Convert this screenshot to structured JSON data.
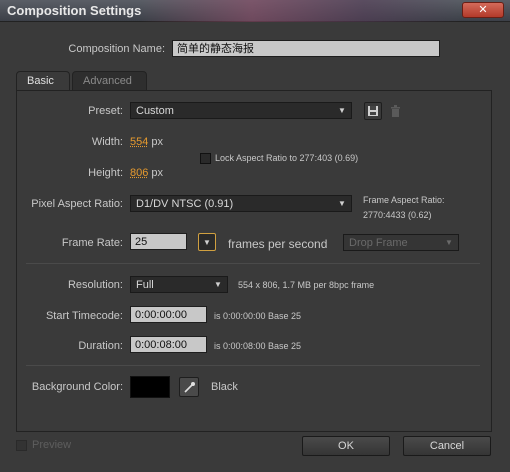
{
  "window": {
    "title": "Composition Settings",
    "close_label": "✕"
  },
  "composition": {
    "name_label": "Composition Name:",
    "name_value": "简单的静态海报"
  },
  "tabs": [
    {
      "label": "Basic"
    },
    {
      "label": "Advanced"
    }
  ],
  "preset": {
    "label": "Preset:",
    "value": "Custom",
    "save_icon": "save-icon",
    "delete_icon": "trash-icon"
  },
  "width": {
    "label": "Width:",
    "value": "554",
    "unit": "px"
  },
  "height": {
    "label": "Height:",
    "value": "806",
    "unit": "px"
  },
  "lock_aspect": {
    "label": "Lock Aspect Ratio to 277:403 (0.69)",
    "checked": false
  },
  "pixel_aspect": {
    "label": "Pixel Aspect Ratio:",
    "value": "D1/DV NTSC (0.91)",
    "frame_aspect_title": "Frame Aspect Ratio:",
    "frame_aspect_value": "2770:4433 (0.62)"
  },
  "frame_rate": {
    "label": "Frame Rate:",
    "value": "25",
    "unit_label": "frames per second",
    "drop_frame": "Drop Frame"
  },
  "resolution": {
    "label": "Resolution:",
    "value": "Full",
    "info": "554 x 806, 1.7 MB per 8bpc frame"
  },
  "start_timecode": {
    "label": "Start Timecode:",
    "value": "0:00:00:00",
    "info": "is 0:00:00:00  Base 25"
  },
  "duration": {
    "label": "Duration:",
    "value": "0:00:08:00",
    "info": "is 0:00:08:00  Base 25"
  },
  "background": {
    "label": "Background Color:",
    "color": "#000000",
    "color_name": "Black"
  },
  "footer": {
    "preview_label": "Preview",
    "ok_label": "OK",
    "cancel_label": "Cancel"
  }
}
